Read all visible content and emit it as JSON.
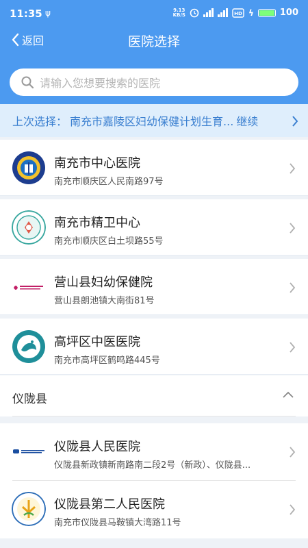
{
  "status": {
    "time": "11:35",
    "speed_value": "9.13",
    "speed_unit": "KB/S",
    "network": "4G",
    "battery": "100"
  },
  "nav": {
    "back_label": "返回",
    "title": "医院选择"
  },
  "search": {
    "placeholder": "请输入您想要搜索的医院"
  },
  "last_selection": {
    "label": "上次选择：",
    "value": "南充市嘉陵区妇幼保健计划生育...",
    "continue_label": "继续"
  },
  "hospitals": [
    {
      "name": "南充市中心医院",
      "address": "南充市顺庆区人民南路97号",
      "logo_icon": "hospital-emblem-icon"
    },
    {
      "name": "南充市精卫中心",
      "address": "南充市顺庆区白土坝路55号",
      "logo_icon": "mental-health-center-icon"
    },
    {
      "name": "营山县妇幼保健院",
      "address": "营山县朗池镇大南街81号",
      "logo_icon": "maternal-health-logo-icon"
    },
    {
      "name": "高坪区中医医院",
      "address": "南充市高坪区鹤鸣路445号",
      "logo_icon": "tcm-hospital-icon"
    }
  ],
  "section": {
    "title": "仪陇县"
  },
  "section_hospitals": [
    {
      "name": "仪陇县人民医院",
      "address": "仪陇县新政镇新南路南二段2号（新政）、仪陇县...",
      "logo_icon": "yilong-people-hospital-icon"
    },
    {
      "name": "仪陇县第二人民医院",
      "address": "南充市仪陇县马鞍镇大湾路11号",
      "logo_icon": "yilong-second-hospital-icon"
    }
  ],
  "colors": {
    "primary": "#4c9af0",
    "accent_text": "#3a7fd0",
    "last_bar_bg": "#dfeefc",
    "page_bg": "#eef2f7"
  }
}
